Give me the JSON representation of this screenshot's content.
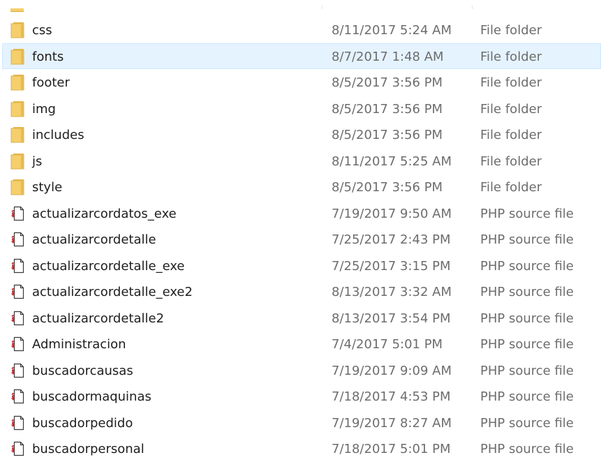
{
  "window": {
    "view": "details"
  },
  "colors": {
    "selection_bg": "#e5f3ff",
    "selection_border": "#cce8ff",
    "folder_yellow": "#f5cf6b",
    "php_icon_red": "#c0282d",
    "meta_text": "#6d6d6d"
  },
  "files": [
    {
      "name": "css",
      "date": "8/11/2017 5:24 AM",
      "type": "File folder",
      "icon": "folder-icon",
      "selected": false
    },
    {
      "name": "fonts",
      "date": "8/7/2017 1:48 AM",
      "type": "File folder",
      "icon": "folder-icon",
      "selected": true
    },
    {
      "name": "footer",
      "date": "8/5/2017 3:56 PM",
      "type": "File folder",
      "icon": "folder-icon",
      "selected": false
    },
    {
      "name": "img",
      "date": "8/5/2017 3:56 PM",
      "type": "File folder",
      "icon": "folder-icon",
      "selected": false
    },
    {
      "name": "includes",
      "date": "8/5/2017 3:56 PM",
      "type": "File folder",
      "icon": "folder-icon",
      "selected": false
    },
    {
      "name": "js",
      "date": "8/11/2017 5:25 AM",
      "type": "File folder",
      "icon": "folder-icon",
      "selected": false
    },
    {
      "name": "style",
      "date": "8/5/2017 3:56 PM",
      "type": "File folder",
      "icon": "folder-icon",
      "selected": false
    },
    {
      "name": "actualizarcordatos_exe",
      "date": "7/19/2017 9:50 AM",
      "type": "PHP source file",
      "icon": "php-file-icon",
      "selected": false
    },
    {
      "name": "actualizarcordetalle",
      "date": "7/25/2017 2:43 PM",
      "type": "PHP source file",
      "icon": "php-file-icon",
      "selected": false
    },
    {
      "name": "actualizarcordetalle_exe",
      "date": "7/25/2017 3:15 PM",
      "type": "PHP source file",
      "icon": "php-file-icon",
      "selected": false
    },
    {
      "name": "actualizarcordetalle_exe2",
      "date": "8/13/2017 3:32 AM",
      "type": "PHP source file",
      "icon": "php-file-icon",
      "selected": false
    },
    {
      "name": "actualizarcordetalle2",
      "date": "8/13/2017 3:54 PM",
      "type": "PHP source file",
      "icon": "php-file-icon",
      "selected": false
    },
    {
      "name": "Administracion",
      "date": "7/4/2017 5:01 PM",
      "type": "PHP source file",
      "icon": "php-file-icon",
      "selected": false
    },
    {
      "name": "buscadorcausas",
      "date": "7/19/2017 9:09 AM",
      "type": "PHP source file",
      "icon": "php-file-icon",
      "selected": false
    },
    {
      "name": "buscadormaquinas",
      "date": "7/18/2017 4:53 PM",
      "type": "PHP source file",
      "icon": "php-file-icon",
      "selected": false
    },
    {
      "name": "buscadorpedido",
      "date": "7/19/2017 8:27 AM",
      "type": "PHP source file",
      "icon": "php-file-icon",
      "selected": false
    },
    {
      "name": "buscadorpersonal",
      "date": "7/18/2017 5:01 PM",
      "type": "PHP source file",
      "icon": "php-file-icon",
      "selected": false
    }
  ]
}
